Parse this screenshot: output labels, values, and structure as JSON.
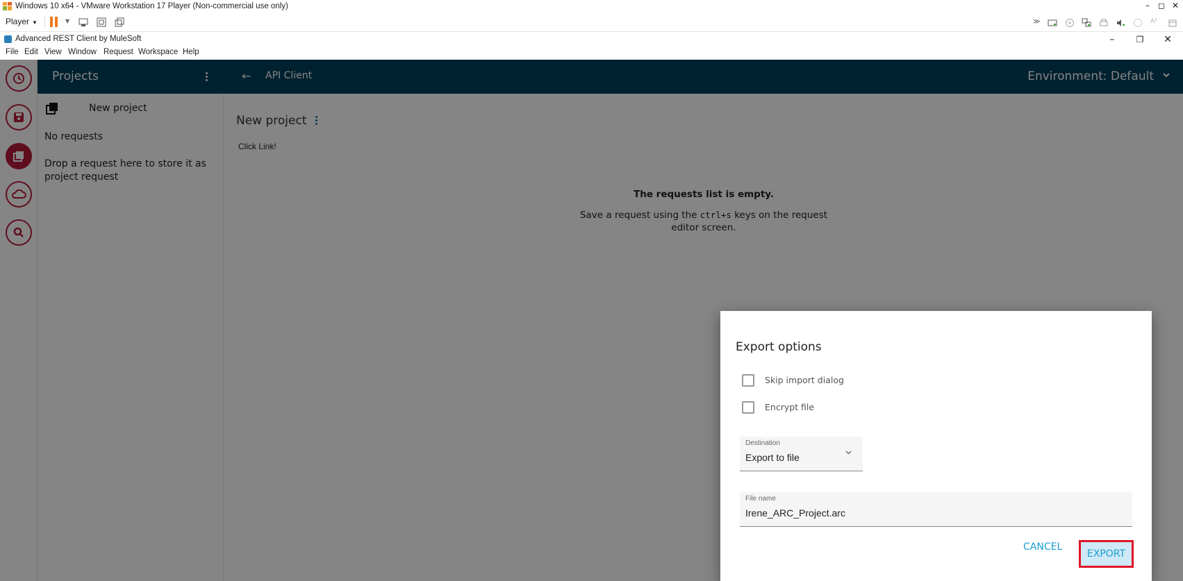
{
  "vm": {
    "title": "Windows 10 x64 - VMware Workstation 17 Player (Non-commercial use only)",
    "player_label": "Player"
  },
  "app": {
    "title": "Advanced REST Client by MuleSoft",
    "menu": [
      "File",
      "Edit",
      "View",
      "Window",
      "Request",
      "Workspace",
      "Help"
    ]
  },
  "projects_panel": {
    "title": "Projects",
    "project_name": "New project",
    "no_requests": "No requests",
    "hint": "Drop a request here to store it as project request"
  },
  "main": {
    "header_title": "API Client",
    "environment": "Environment: Default",
    "project_title": "New project",
    "click_link": "Click Link!",
    "empty_title": "The requests list is empty.",
    "empty_line1_pre": "Save a request using the ",
    "empty_line1_code": "ctrl+s",
    "empty_line1_post": " keys on the request",
    "empty_line2": "editor screen."
  },
  "dialog": {
    "title": "Export options",
    "skip_import": "Skip import dialog",
    "encrypt": "Encrypt file",
    "destination_label": "Destination",
    "destination_value": "Export to file",
    "filename_label": "File name",
    "filename_value": "Irene_ARC_Project.arc",
    "cancel": "CANCEL",
    "export": "EXPORT"
  },
  "colors": {
    "header": "#01405a",
    "accent": "#b71c3c",
    "link": "#1a9dd0",
    "highlight": "#e0152a"
  }
}
